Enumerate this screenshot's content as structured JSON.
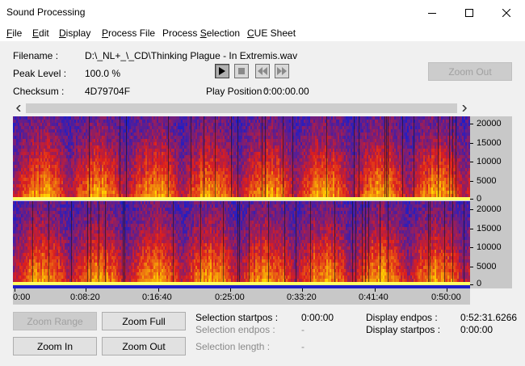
{
  "window": {
    "title": "Sound Processing"
  },
  "menu": [
    {
      "label": "File",
      "accel": "F",
      "rest": "ile"
    },
    {
      "label": "Edit",
      "accel": "E",
      "rest": "dit"
    },
    {
      "label": "Display",
      "accel": "D",
      "rest": "isplay"
    },
    {
      "label": "Process File",
      "accel": "P",
      "rest": "rocess File"
    },
    {
      "label": "Process Selection",
      "accel": "",
      "rest": "Process ",
      "accel2": "S",
      "rest2": "election"
    },
    {
      "label": "CUE Sheet",
      "accel": "C",
      "rest": "UE Sheet"
    }
  ],
  "info": {
    "filename_label": "Filename :",
    "filename_value": "D:\\_NL+_\\_CD\\Thinking Plague - In Extremis.wav",
    "peak_label": "Peak Level :",
    "peak_value": "100.0 %",
    "checksum_label": "Checksum :",
    "checksum_value": "4D79704F",
    "play_position_label": "Play Position :",
    "play_position_value": "0:00:00.00"
  },
  "transport": {
    "play_icon": "play-icon",
    "stop_icon": "stop-icon",
    "rewind_icon": "rewind-icon",
    "forward_icon": "fast-forward-icon"
  },
  "buttons": {
    "zoom_out_top": "Zoom Out",
    "zoom_range": "Zoom Range",
    "zoom_full": "Zoom Full",
    "zoom_in": "Zoom In",
    "zoom_out": "Zoom Out"
  },
  "frequency_axis": [
    "20000",
    "15000",
    "10000",
    "5000",
    "0"
  ],
  "time_axis": [
    "0:00",
    "0:08:20",
    "0:16:40",
    "0:25:00",
    "0:33:20",
    "0:41:40",
    "0:50:00"
  ],
  "selection": {
    "startpos_label": "Selection startpos :",
    "startpos_value": "0:00:00",
    "endpos_label": "Selection endpos :",
    "endpos_value": "-",
    "length_label": "Selection length :",
    "length_value": "-"
  },
  "display": {
    "endpos_label": "Display endpos :",
    "endpos_value": "0:52:31.6266",
    "startpos_label": "Display startpos :",
    "startpos_value": "0:00:00"
  },
  "colors": {
    "spectro_low": "#1e1ec8",
    "spectro_mid": "#dc1e1e",
    "spectro_high": "#ffd200",
    "peak": "#ffff64"
  }
}
